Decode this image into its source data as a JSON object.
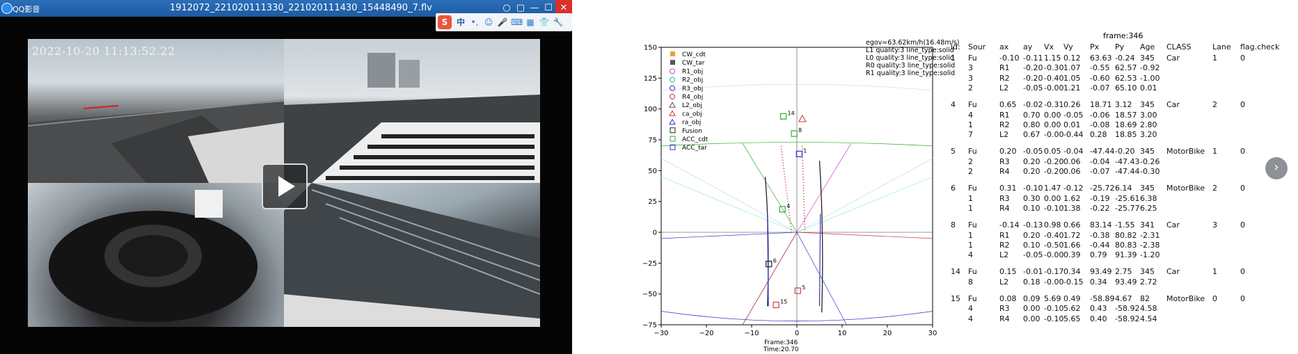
{
  "player": {
    "app_name": "QQ影音",
    "file_title": "1912072_221020111330_221020111430_15448490_7.flv",
    "video_timestamp": "2022-10-20  11:13:52.22",
    "buttons": {
      "close": "✕",
      "maximize": "☐",
      "minimize": "—",
      "restore": "▭",
      "settings": "▢",
      "pin": "○"
    },
    "ime_toolbar": {
      "logo": "S",
      "lang": "中",
      "items": [
        "•,",
        "☺",
        "🎤",
        "⌨",
        "▦",
        "👕",
        "🔧"
      ]
    }
  },
  "plot": {
    "info_lines": [
      "egov=63.62km/h(16.48m/s)",
      "L1 quality:3 line_type:solid",
      "L0 quality:3 line_type:solid",
      "R0 quality:3 line_type:solid",
      "R1 quality:3 line_type:solid"
    ],
    "footer_frame": "Frame:346",
    "footer_time": "Time:20.70",
    "x_ticks": [
      "−30",
      "−20",
      "−10",
      "0",
      "10",
      "20",
      "30"
    ],
    "y_ticks": [
      "150",
      "125",
      "100",
      "75",
      "50",
      "25",
      "0",
      "−25",
      "−50",
      "−75"
    ],
    "legend": [
      "CW_cdt",
      "CW_tar",
      "R1_obj",
      "R2_obj",
      "R3_obj",
      "R4_obj",
      "L2_obj",
      "ca_obj",
      "ra_obj",
      "Fusion",
      "ACC_cdt",
      "ACC_tar"
    ],
    "object_labels": [
      "14",
      "8",
      "1",
      "4",
      "6",
      "5",
      "15"
    ]
  },
  "table": {
    "frame": "frame:346",
    "headers": [
      "id:",
      "Sour",
      "ax",
      "ay",
      "Vx",
      "Vy",
      "Px",
      "Py",
      "Age",
      "CLASS",
      "Lane",
      "flag.check"
    ],
    "rows": [
      [
        "1",
        "Fu",
        "-0.10",
        "-0.11",
        "1.15",
        "0.12",
        "63.63",
        "-0.24",
        "345",
        "Car",
        "1",
        "0"
      ],
      [
        "",
        "3",
        "R1",
        "-0.20",
        "-0.30",
        "1.07",
        "-0.55",
        "62.57",
        "-0.92",
        "",
        "",
        ""
      ],
      [
        "",
        "3",
        "R2",
        "-0.20",
        "-0.40",
        "1.05",
        "-0.60",
        "62.53",
        "-1.00",
        "",
        "",
        ""
      ],
      [
        "",
        "2",
        "L2",
        "-0.05",
        "-0.00",
        "1.21",
        "-0.07",
        "65.10",
        "0.01",
        "",
        "",
        ""
      ],
      [
        "4",
        "Fu",
        "0.65",
        "-0.02",
        "-0.31",
        "0.26",
        "18.71",
        "3.12",
        "345",
        "Car",
        "2",
        "0"
      ],
      [
        "",
        "4",
        "R1",
        "0.70",
        "0.00",
        "-0.05",
        "-0.06",
        "18.57",
        "3.00",
        "",
        "",
        ""
      ],
      [
        "",
        "1",
        "R2",
        "0.80",
        "0.00",
        "0.01",
        "-0.08",
        "18.69",
        "2.80",
        "",
        "",
        ""
      ],
      [
        "",
        "7",
        "L2",
        "0.67",
        "-0.00",
        "-0.44",
        "0.28",
        "18.85",
        "3.20",
        "",
        "",
        ""
      ],
      [
        "5",
        "Fu",
        "0.20",
        "-0.05",
        "0.05",
        "-0.04",
        "-47.44",
        "-0.20",
        "345",
        "MotorBike",
        "1",
        "0"
      ],
      [
        "",
        "2",
        "R3",
        "0.20",
        "-0.20",
        "0.06",
        "-0.04",
        "-47.43",
        "-0.26",
        "",
        "",
        ""
      ],
      [
        "",
        "2",
        "R4",
        "0.20",
        "-0.20",
        "0.06",
        "-0.07",
        "-47.44",
        "-0.30",
        "",
        "",
        ""
      ],
      [
        "6",
        "Fu",
        "0.31",
        "-0.10",
        "1.47",
        "-0.12",
        "-25.72",
        "6.14",
        "345",
        "MotorBike",
        "2",
        "0"
      ],
      [
        "",
        "1",
        "R3",
        "0.30",
        "0.00",
        "1.62",
        "-0.19",
        "-25.61",
        "6.38",
        "",
        "",
        ""
      ],
      [
        "",
        "1",
        "R4",
        "0.10",
        "-0.10",
        "1.38",
        "-0.22",
        "-25.77",
        "6.25",
        "",
        "",
        ""
      ],
      [
        "8",
        "Fu",
        "-0.14",
        "-0.13",
        "0.98",
        "0.66",
        "83.14",
        "-1.55",
        "341",
        "Car",
        "3",
        "0"
      ],
      [
        "",
        "1",
        "R1",
        "0.20",
        "-0.40",
        "1.72",
        "-0.38",
        "80.82",
        "-2.31",
        "",
        "",
        ""
      ],
      [
        "",
        "1",
        "R2",
        "0.10",
        "-0.50",
        "1.66",
        "-0.44",
        "80.83",
        "-2.38",
        "",
        "",
        ""
      ],
      [
        "",
        "4",
        "L2",
        "-0.05",
        "-0.00",
        "0.39",
        "0.79",
        "91.39",
        "-1.20",
        "",
        "",
        ""
      ],
      [
        "14",
        "Fu",
        "0.15",
        "-0.01",
        "-0.17",
        "0.34",
        "93.49",
        "2.75",
        "345",
        "Car",
        "1",
        "0"
      ],
      [
        "",
        "8",
        "L2",
        "0.18",
        "-0.00",
        "-0.15",
        "0.34",
        "93.49",
        "2.72",
        "",
        "",
        ""
      ],
      [
        "15",
        "Fu",
        "0.08",
        "0.09",
        "5.69",
        "0.49",
        "-58.89",
        "4.67",
        "82",
        "MotorBike",
        "0",
        "0"
      ],
      [
        "",
        "4",
        "R3",
        "0.00",
        "-0.10",
        "5.62",
        "0.43",
        "-58.92",
        "4.58",
        "",
        "",
        ""
      ],
      [
        "",
        "4",
        "R4",
        "0.00",
        "-0.10",
        "5.65",
        "0.40",
        "-58.92",
        "4.54",
        "",
        "",
        ""
      ]
    ]
  }
}
